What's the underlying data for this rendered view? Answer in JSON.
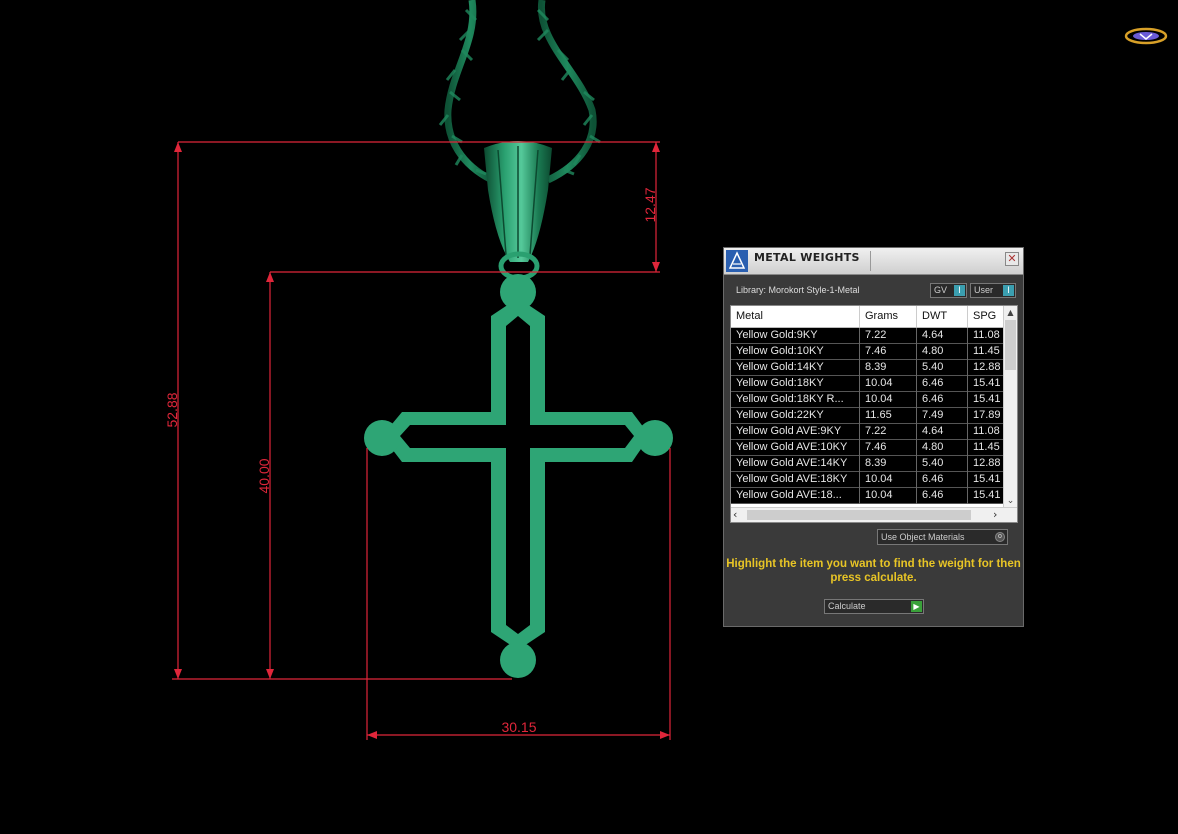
{
  "viewport": {
    "background": "#000000",
    "model_color": "#2ea575",
    "dimension_color": "#e0263a",
    "dimensions": {
      "bail_height": "12.47",
      "total_height": "52.88",
      "cross_height": "40.00",
      "cross_width": "30.15"
    }
  },
  "logo": {
    "icon": "brand-logo-icon"
  },
  "panel": {
    "title": "METAL WEIGHTS",
    "title_icon": "metal-weights-app-icon",
    "close_icon": "close-icon",
    "library_label": "Library: Morokort Style-1-Metal",
    "toggles": {
      "gv": "GV",
      "user": "User"
    },
    "table": {
      "columns": [
        "Metal",
        "Grams",
        "DWT",
        "SPG"
      ],
      "rows": [
        [
          "Yellow Gold:9KY",
          "7.22",
          "4.64",
          "11.08"
        ],
        [
          "Yellow Gold:10KY",
          "7.46",
          "4.80",
          "11.45"
        ],
        [
          "Yellow Gold:14KY",
          "8.39",
          "5.40",
          "12.88"
        ],
        [
          "Yellow Gold:18KY",
          "10.04",
          "6.46",
          "15.41"
        ],
        [
          "Yellow Gold:18KY R...",
          "10.04",
          "6.46",
          "15.41"
        ],
        [
          "Yellow Gold:22KY",
          "11.65",
          "7.49",
          "17.89"
        ],
        [
          "Yellow Gold AVE:9KY",
          "7.22",
          "4.64",
          "11.08"
        ],
        [
          "Yellow Gold AVE:10KY",
          "7.46",
          "4.80",
          "11.45"
        ],
        [
          "Yellow Gold AVE:14KY",
          "8.39",
          "5.40",
          "12.88"
        ],
        [
          "Yellow Gold AVE:18KY",
          "10.04",
          "6.46",
          "15.41"
        ],
        [
          "Yellow Gold AVE:18...",
          "10.04",
          "6.46",
          "15.41"
        ]
      ]
    },
    "use_object_materials": "Use Object Materials",
    "hint": "Highlight the item you want to find the weight for then press calculate.",
    "calculate_label": "Calculate",
    "colors": {
      "panel_bg": "#3a3a3a",
      "hint": "#e8c526",
      "toggle_knob": "#3b9fb0",
      "calc_knob": "#3aa13a"
    }
  }
}
